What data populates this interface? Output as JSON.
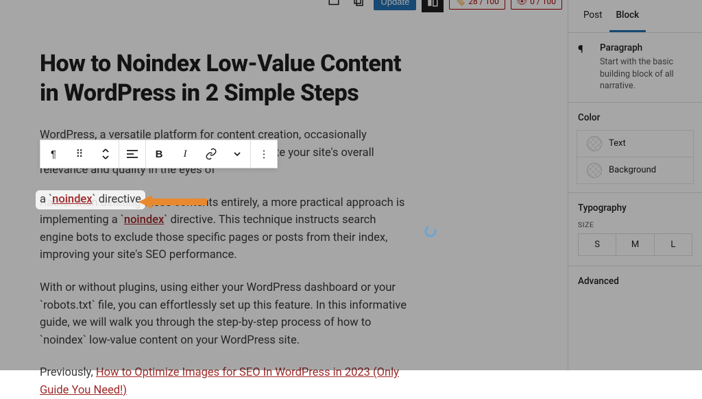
{
  "topbar": {
    "update_label": "Update",
    "seo1": "28 / 100",
    "seo2": "0 / 100"
  },
  "content": {
    "title": "How to Noindex Low-Value Content in WordPress in 2 Simple Steps",
    "p1": "WordPress, a versatile platform for content creation, occasionally accumulates low-value content, which may dilute your site's overall relevance and quality in the eyes of",
    "p2a": "Rather than deleting these contents entirely, a more practical approach is implementing a `",
    "p2_noindex": "noindex",
    "p2b": "` directive. This technique instructs search engine bots to exclude those specific pages or posts from their index, improving your site's SEO performance.",
    "p3": "With or without plugins, using either your WordPress dashboard or your `robots.txt` file, you can effortlessly set up this feature. In this informative guide, we will walk you through the step-by-step process of how to `noindex` low-value content on your WordPress site.",
    "p4_prefix": "Previously, ",
    "p4_link": "How to Optimize Images for SEO In WordPress in 2023 (Only Guide You Need!)"
  },
  "highlight": {
    "prefix": "a `",
    "noindex": "noindex",
    "suffix": "` directive."
  },
  "sidebar": {
    "tabs": {
      "post": "Post",
      "block": "Block"
    },
    "block": {
      "name": "Paragraph",
      "desc": "Start with the basic building block of all narrative."
    },
    "color": {
      "title": "Color",
      "text": "Text",
      "background": "Background"
    },
    "typography": {
      "title": "Typography",
      "size_label": "SIZE",
      "sizes": [
        "S",
        "M",
        "L"
      ]
    },
    "advanced": "Advanced"
  }
}
